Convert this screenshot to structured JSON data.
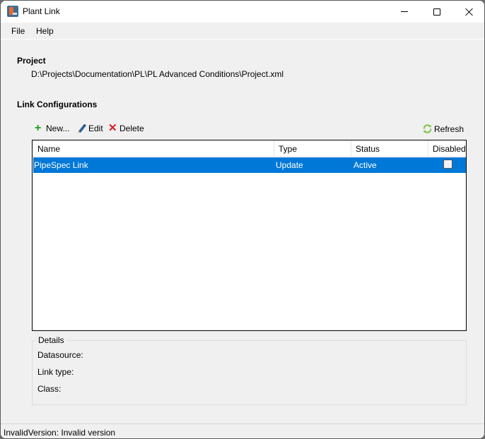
{
  "window": {
    "title": "Plant Link",
    "app_icon": "plant-link-app-icon",
    "controls": {
      "minimize": "minimize-icon",
      "maximize": "maximize-icon",
      "close": "close-icon"
    }
  },
  "menu": {
    "items": [
      {
        "label": "File"
      },
      {
        "label": "Help"
      }
    ]
  },
  "project": {
    "heading": "Project",
    "path": "D:\\Projects\\Documentation\\PL\\PL Advanced Conditions\\Project.xml"
  },
  "link_configurations": {
    "heading": "Link Configurations",
    "toolbar": {
      "new_label": "New...",
      "edit_label": "Edit",
      "delete_label": "Delete",
      "refresh_label": "Refresh"
    },
    "table": {
      "columns": [
        "Name",
        "Type",
        "Status",
        "Disabled"
      ],
      "rows": [
        {
          "name": "PipeSpec Link",
          "type": "Update",
          "status": "Active",
          "disabled": false,
          "selected": true
        }
      ]
    }
  },
  "details": {
    "legend": "Details",
    "datasource_label": "Datasource:",
    "link_type_label": "Link type:",
    "class_label": "Class:"
  },
  "status_bar": {
    "text": "InvalidVersion: Invalid version"
  },
  "colors": {
    "selection": "#0078d7",
    "add_icon": "#1f9c1f",
    "delete_icon": "#e01b1b",
    "refresh_icon": "#7cc142"
  }
}
